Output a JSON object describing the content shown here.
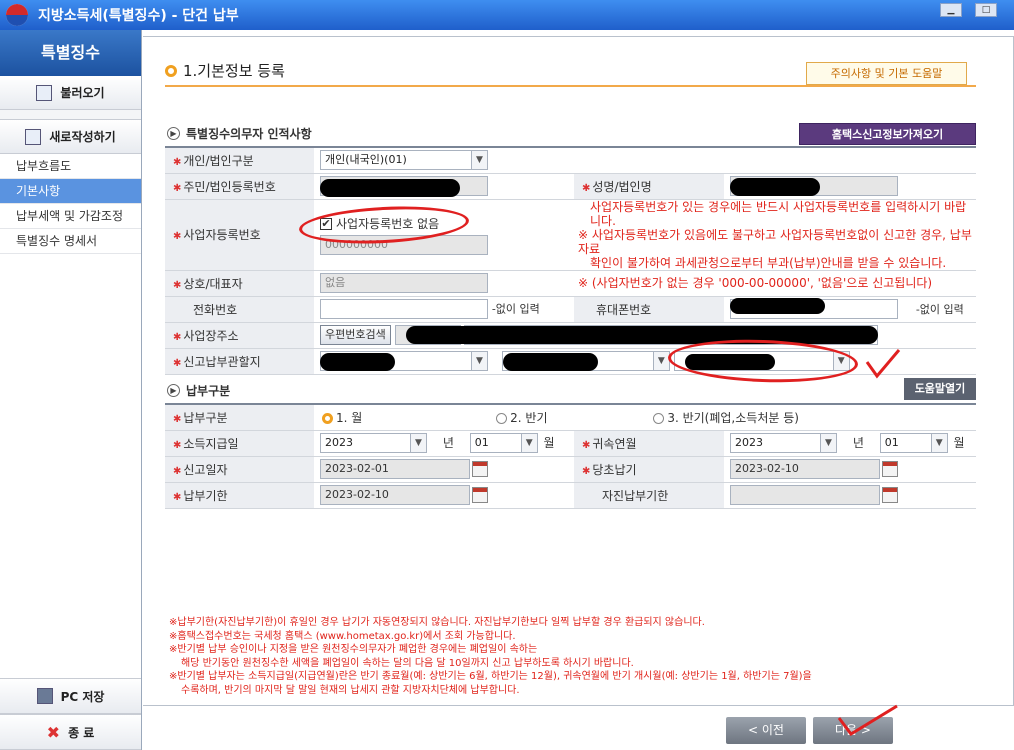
{
  "window": {
    "title": "지방소득세(특별징수) - 단건 납부"
  },
  "sidebar": {
    "header": "특별징수",
    "load_btn": "불러오기",
    "new_btn": "새로작성하기",
    "menu": [
      "납부흐름도",
      "기본사항",
      "납부세액 및 가감조정",
      "특별징수 명세서"
    ],
    "pc_save": "PC 저장",
    "exit": "종 료"
  },
  "page": {
    "section_title": "1.기본정보 등록",
    "help_tab": "주의사항 및 기본 도움말"
  },
  "taxpayer": {
    "heading": "특별징수의무자 인적사항",
    "hometax_btn": "홈택스신고정보가져오기",
    "type_label": "개인/법인구분",
    "type_value": "개인(내국인)(01)",
    "regno_label": "주민/법인등록번호",
    "name_label": "성명/법인명",
    "bizno_label": "사업자등록번호",
    "bizno_none_label": "사업자등록번호 없음",
    "bizno_value": "000000000",
    "bizno_note": [
      "사업자등록번호가 있는 경우에는 반드시 사업자등록번호를 입력하시기 바랍니다.",
      "※ 사업자등록번호가 있음에도 불구하고 사업자등록번호없이 신고한 경우, 납부자료",
      "확인이 불가하여 과세관청으로부터 부과(납부)안내를 받을 수 있습니다."
    ],
    "company_label": "상호/대표자",
    "company_value": "없음",
    "company_note": "※ (사업자번호가 없는 경우 '000-00-00000', '없음'으로 신고됩니다)",
    "phone_label": "전화번호",
    "phone_suffix": "-없이 입력",
    "mobile_label": "휴대폰번호",
    "mobile_suffix": "-없이 입력",
    "addr_label": "사업장주소",
    "postcode_btn": "우편번호검색",
    "office_label": "신고납부관할지"
  },
  "payment": {
    "heading": "납부구분",
    "help_btn": "도움말열기",
    "type_label": "납부구분",
    "opt1": "1. 월",
    "opt2": "2. 반기",
    "opt3": "3. 반기(폐업,소득처분 등)",
    "income_label": "소득지급일",
    "income_year": "2023",
    "year_word": "년",
    "income_month": "01",
    "month_word": "월",
    "attrib_label": "귀속연월",
    "attrib_year": "2023",
    "attrib_month": "01",
    "report_label": "신고일자",
    "report_date": "2023-02-01",
    "orig_label": "당초납기",
    "orig_date": "2023-02-10",
    "due_label": "납부기한",
    "due_date": "2023-02-10",
    "self_label": "자진납부기한"
  },
  "notes": [
    "※납부기한(자진납부기한)이 휴일인 경우 납기가 자동연장되지 않습니다. 자진납부기한보다 일찍 납부할 경우 환급되지 않습니다.",
    "※홈택스접수번호는 국세청 홈택스 (www.hometax.go.kr)에서 조회 가능합니다.",
    "※반기별 납부 승인이나 지정을 받은 원천징수의무자가 폐업한 경우에는 폐업일이 속하는",
    "해당 반기동안 원천징수한 세액을 폐업일이 속하는 달의 다음 달 10일까지 신고 납부하도록 하시기 바랍니다.",
    "※반기별 납부자는 소득지급일(지급연월)란은 반기 종료월(예: 상반기는 6월, 하반기는 12월), 귀속연월에 반기 개시월(예: 상반기는 1월, 하반기는 7월)을",
    "수록하며, 반기의 마지막 달 말일 현재의 납세지 관할 지방자치단체에 납부합니다."
  ],
  "nav": {
    "prev": "< 이전",
    "next": "다음 >"
  }
}
